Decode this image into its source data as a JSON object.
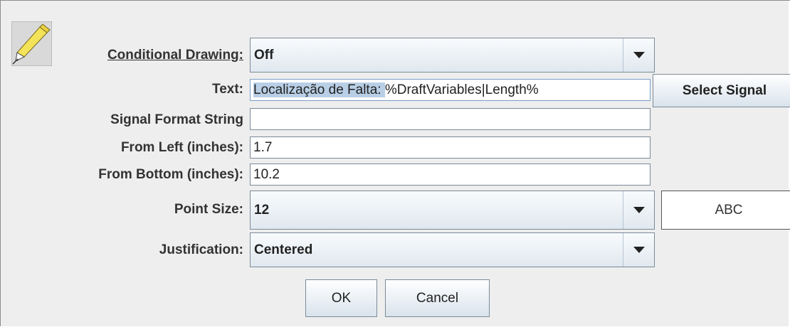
{
  "labels": {
    "conditional_drawing": "Conditional Drawing:",
    "text": "Text:",
    "signal_format": "Signal Format String",
    "from_left": "From Left (inches):",
    "from_bottom": "From Bottom (inches):",
    "point_size": "Point Size:",
    "justification": "Justification:"
  },
  "values": {
    "conditional_drawing": "Off",
    "text_selected": "Localização de Falta: ",
    "text_rest": "%DraftVariables|Length%",
    "signal_format": "",
    "from_left": "1.7",
    "from_bottom": "10.2",
    "point_size": "12",
    "justification": "Centered"
  },
  "preview_text": "ABC",
  "buttons": {
    "select_signal": "Select Signal",
    "ok": "OK",
    "cancel": "Cancel"
  },
  "icons": {
    "tool": "pencil-icon",
    "dropdown": "chevron-down-icon"
  },
  "colors": {
    "dialog_bg": "#eeeeee",
    "selection": "#b8cfe5",
    "border": "#7a8a99"
  }
}
